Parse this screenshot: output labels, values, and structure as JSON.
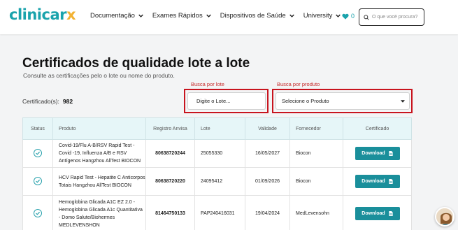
{
  "header": {
    "logo_main": "clinicar",
    "logo_x": "x",
    "nav": [
      {
        "label": "Documentação"
      },
      {
        "label": "Exames Rápidos"
      },
      {
        "label": "Dispositivos de Saúde"
      },
      {
        "label": "University"
      }
    ],
    "favorites_count": "0",
    "search_placeholder": "O que você procura?"
  },
  "page": {
    "title": "Certificados de qualidade lote a lote",
    "subtitle": "Consulte as certificações pelo o lote ou nome do produto.",
    "count_label": "Certificado(s):",
    "count_value": "982"
  },
  "filters": {
    "lot_label": "Busca por lote",
    "lot_placeholder": "Digite o Lote...",
    "product_label": "Busca por produto",
    "product_selected": "Selecione o Produto"
  },
  "table": {
    "headers": [
      "Status",
      "Produto",
      "Registro Anvisa",
      "Lote",
      "Validade",
      "Fornecedor",
      "Certificado"
    ],
    "rows": [
      {
        "product": "Covid-19/Flu A-B/RSV Rapid Test - Covid -19, Influenza A/B e RSV Antígenos Hangzhou AllTest BIOCON",
        "anvisa": "80638720244",
        "lote": "25055330",
        "validade": "16/05/2027",
        "fornecedor": "Biocon",
        "certificado": "Download"
      },
      {
        "product": "HCV Rapid Test - Hepatite C Anticorpos Totais Hangzhou AllTest BIOCON",
        "anvisa": "80638720220",
        "lote": "24095412",
        "validade": "01/09/2026",
        "fornecedor": "Biocon",
        "certificado": "Download"
      },
      {
        "product": "Hemoglobina Glicada A1C EZ 2.0 - Hemoglobina Glicada A1c Quantitativa - Domo Salute/Biohermes MEDLEVENSHON",
        "anvisa": "81464750133",
        "lote": "PAP240416031",
        "validade": "19/04/2024",
        "fornecedor": "MedLevensohn",
        "certificado": "Download"
      }
    ]
  },
  "colors": {
    "brand": "#1aa3ac",
    "accent": "#f2b233",
    "button": "#1a8f9b",
    "highlight": "#c8141e"
  }
}
